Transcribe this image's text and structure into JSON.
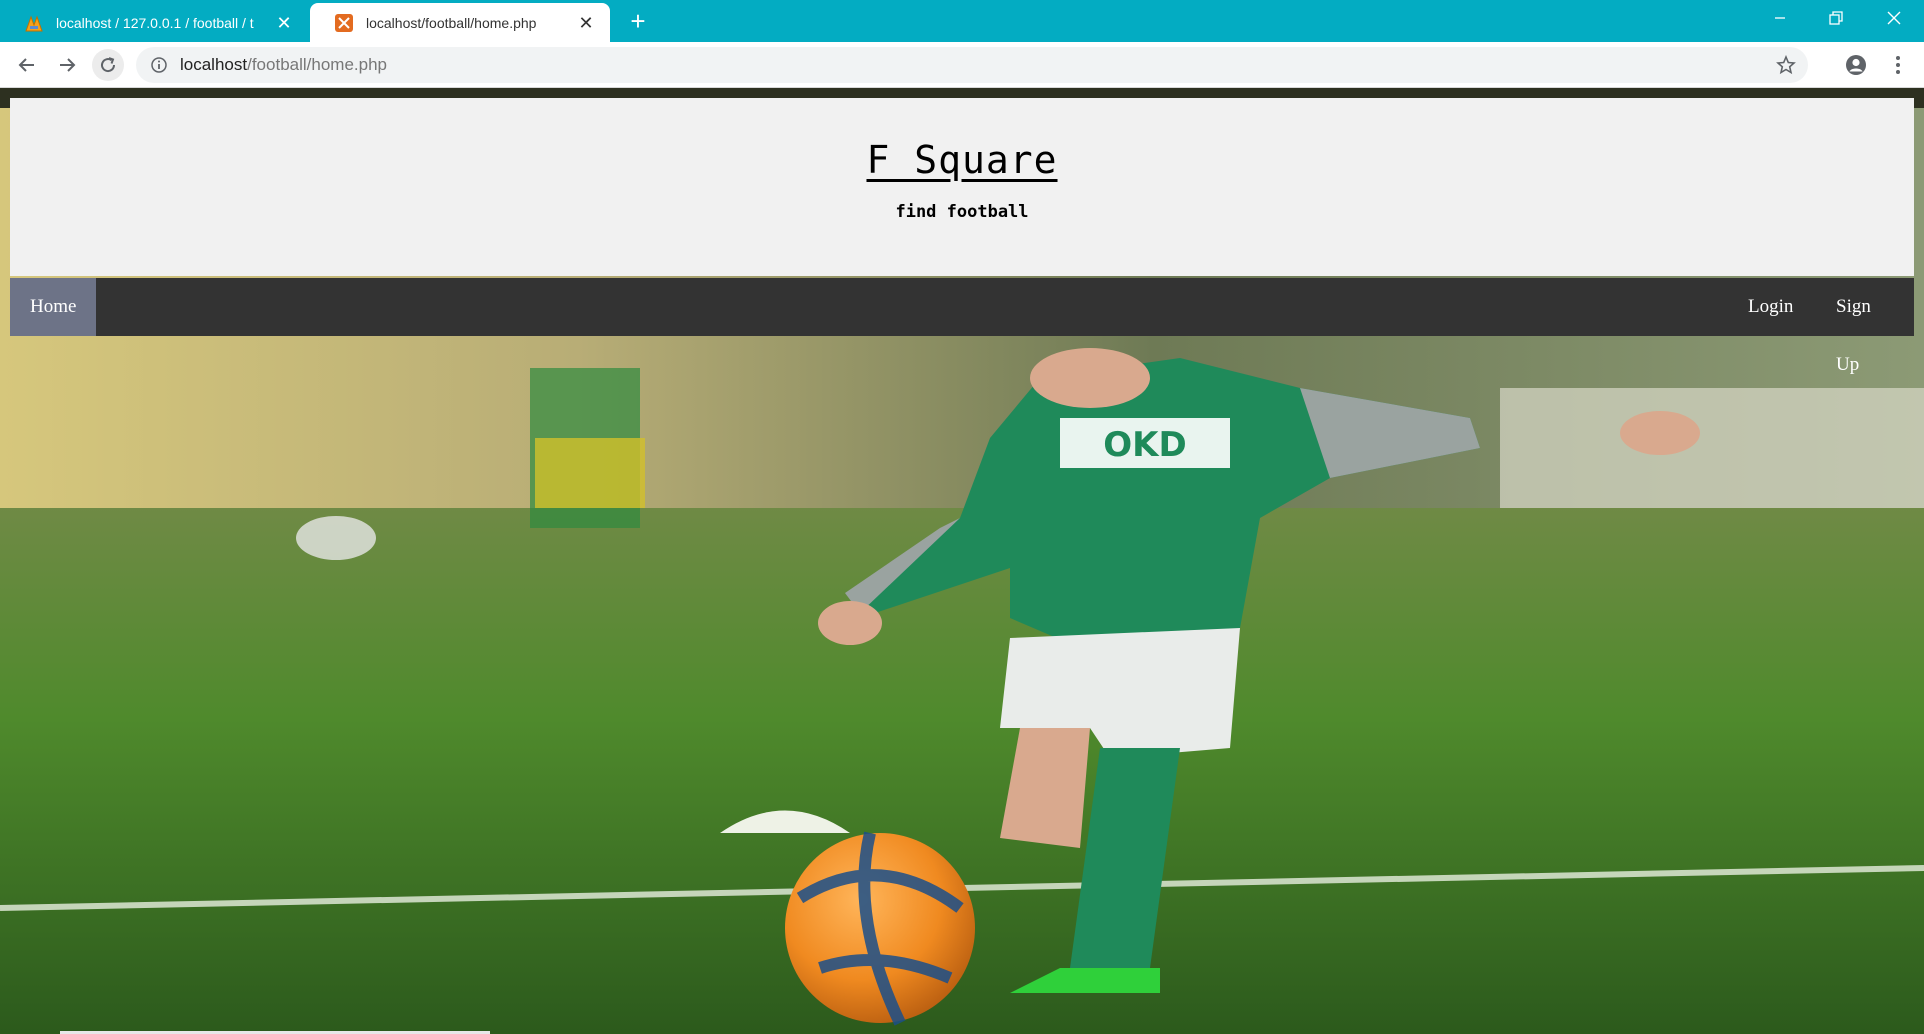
{
  "browser": {
    "tabs": [
      {
        "title": "localhost / 127.0.0.1 / football / t",
        "active": false
      },
      {
        "title": "localhost/football/home.php",
        "active": true
      }
    ],
    "address": {
      "host": "localhost",
      "path": "/football/home.php"
    }
  },
  "site": {
    "title": "F Square",
    "tagline": "find football",
    "nav": {
      "home": "Home",
      "login": "Login",
      "signup": "Sign Up"
    }
  },
  "hero": {
    "jersey_text": "OKD"
  },
  "colors": {
    "tabbar": "#03acc2",
    "header_bg": "#f1f1f1",
    "nav_bg": "#333333",
    "nav_active": "#6d7387"
  }
}
